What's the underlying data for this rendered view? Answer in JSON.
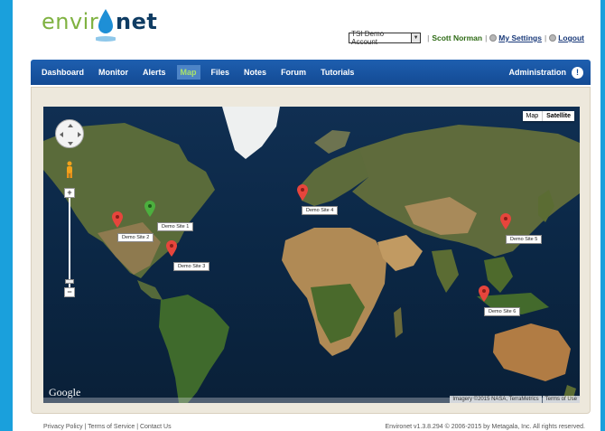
{
  "logo": {
    "part1": "enviro",
    "part2": "net"
  },
  "account": {
    "selected": "TSI Demo Account",
    "user": "Scott Norman",
    "settings_link": "My Settings",
    "logout_link": "Logout"
  },
  "nav": {
    "items": [
      "Dashboard",
      "Monitor",
      "Alerts",
      "Map",
      "Files",
      "Notes",
      "Forum",
      "Tutorials"
    ],
    "active": "Map",
    "admin_label": "Administration"
  },
  "map": {
    "type_map": "Map",
    "type_satellite": "Satellite",
    "selected_type": "Satellite",
    "google_logo": "Google",
    "attribution": "Imagery ©2015 NASA, TerraMetrics",
    "terms": "Terms of Use",
    "sites": [
      {
        "label": "Demo Site 1",
        "color": "#4caf3e"
      },
      {
        "label": "Demo Site 2",
        "color": "#e6453c"
      },
      {
        "label": "Demo Site 3",
        "color": "#e6453c"
      },
      {
        "label": "Demo Site 4",
        "color": "#e6453c"
      },
      {
        "label": "Demo Site 5",
        "color": "#e6453c"
      },
      {
        "label": "Demo Site 6",
        "color": "#e6453c"
      }
    ]
  },
  "footer": {
    "links": "Privacy Policy  |  Terms of Service  |  Contact Us",
    "copyright": "Environet v1.3.8.294 © 2006-2015 by Metagala, Inc. All rights reserved."
  },
  "colors": {
    "nav": "#1a5aa8",
    "brand_green": "#7fb241",
    "brand_blue": "#0f3c63",
    "background": "#1aa0dc"
  }
}
